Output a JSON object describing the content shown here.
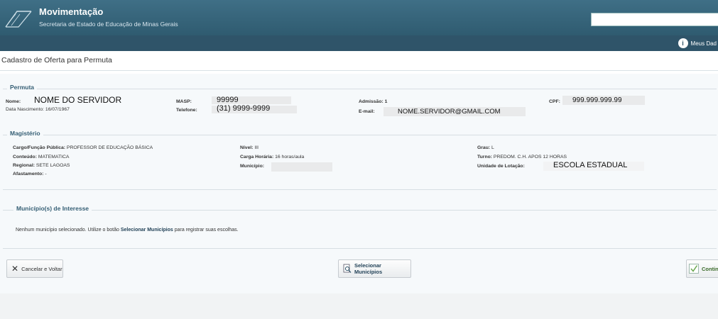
{
  "header": {
    "app_title": "Movimentação",
    "app_subtitle": "Secretaria de Estado de Educação de Minas Gerais",
    "user_link": "Meus Dad"
  },
  "page": {
    "title": "Cadastro de Oferta para Permuta"
  },
  "permuta": {
    "legend": "Permuta",
    "nome_label": "Nome:",
    "nome_value": "NOME DO SERVIDOR",
    "data_nasc": "Data Nascimento: 16/07/1967",
    "masp_label": "MASP:",
    "masp_value": "99999",
    "telefone_label": "Telefone:",
    "telefone_value": "(31) 9999-9999",
    "admissao": "Admissão: 1",
    "email_label": "E-mail:",
    "email_value": "NOME.SERVIDOR@GMAIL.COM",
    "cpf_label": "CPF:",
    "cpf_value": "999.999.999.99"
  },
  "magisterio": {
    "legend": "Magistério",
    "cargo_label": "Cargo/Função Pública:",
    "cargo_value": "PROFESSOR DE EDUCAÇÃO BÁSICA",
    "conteudo_label": "Conteúdo:",
    "conteudo_value": "MATEMATICA",
    "regional_label": "Regional:",
    "regional_value": "SETE LAGOAS",
    "afastamento_label": "Afastamento:",
    "afastamento_value": "-",
    "nivel_label": "Nível:",
    "nivel_value": "III",
    "carga_label": "Carga Horária:",
    "carga_value": "16 horas/aula",
    "municipio_label": "Município:",
    "grau_label": "Grau:",
    "grau_value": "L",
    "turno_label": "Turno:",
    "turno_value": "PREDOM. C.H. APOS 12 HORAS",
    "unidade_label": "Unidade de Lotação:",
    "unidade_value": "ESCOLA ESTADUAL"
  },
  "municipios": {
    "legend": "Município(s) de Interesse",
    "msg_pre": "Nenhum município selecionado. Utilize o botão ",
    "msg_link": "Selecionar Municípios",
    "msg_post": " para registrar suas escolhas."
  },
  "buttons": {
    "cancel": "Cancelar e Voltar",
    "select": "Selecionar Municípios",
    "continue": "Continu"
  },
  "colors": {
    "header": "#3f6f86",
    "nav": "#2f5469",
    "legend": "#365f75"
  },
  "icons": {
    "close": "close-icon",
    "search_doc": "document-search-icon",
    "check": "check-icon",
    "user": "user-icon"
  }
}
